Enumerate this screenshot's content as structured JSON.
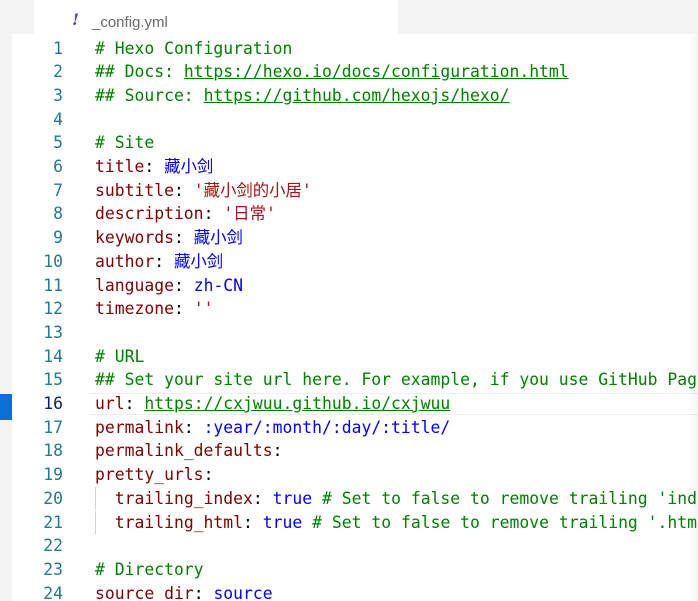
{
  "tab": {
    "icon": "yaml-exclamation-icon",
    "filename": "_config.yml"
  },
  "colors": {
    "key": "#800000",
    "comment": "#008000",
    "value": "#0000ff",
    "string": "#a31515",
    "line_number": "#237893",
    "active_line_number": "#0b216f",
    "activity_marker": "#0a6fd6"
  },
  "editor": {
    "active_line": 16,
    "lines": [
      {
        "number": "1",
        "parts": [
          {
            "t": "c",
            "text": "# Hexo Configuration"
          }
        ]
      },
      {
        "number": "2",
        "parts": [
          {
            "t": "c",
            "text": "## Docs: "
          },
          {
            "t": "u",
            "text": "https://hexo.io/docs/configuration.html"
          }
        ]
      },
      {
        "number": "3",
        "parts": [
          {
            "t": "c",
            "text": "## Source: "
          },
          {
            "t": "u",
            "text": "https://github.com/hexojs/hexo/"
          }
        ]
      },
      {
        "number": "4",
        "parts": []
      },
      {
        "number": "5",
        "parts": [
          {
            "t": "c",
            "text": "# Site"
          }
        ]
      },
      {
        "number": "6",
        "parts": [
          {
            "t": "k",
            "text": "title"
          },
          {
            "t": "p",
            "text": ": "
          },
          {
            "t": "v",
            "text": "藏小剑"
          }
        ]
      },
      {
        "number": "7",
        "parts": [
          {
            "t": "k",
            "text": "subtitle"
          },
          {
            "t": "p",
            "text": ": "
          },
          {
            "t": "s",
            "text": "'藏小剑的小居'"
          }
        ]
      },
      {
        "number": "8",
        "parts": [
          {
            "t": "k",
            "text": "description"
          },
          {
            "t": "p",
            "text": ": "
          },
          {
            "t": "s",
            "text": "'日常'"
          }
        ]
      },
      {
        "number": "9",
        "parts": [
          {
            "t": "k",
            "text": "keywords"
          },
          {
            "t": "p",
            "text": ": "
          },
          {
            "t": "v",
            "text": "藏小剑"
          }
        ]
      },
      {
        "number": "10",
        "parts": [
          {
            "t": "k",
            "text": "author"
          },
          {
            "t": "p",
            "text": ": "
          },
          {
            "t": "v",
            "text": "藏小剑"
          }
        ]
      },
      {
        "number": "11",
        "parts": [
          {
            "t": "k",
            "text": "language"
          },
          {
            "t": "p",
            "text": ": "
          },
          {
            "t": "v",
            "text": "zh-CN"
          }
        ]
      },
      {
        "number": "12",
        "parts": [
          {
            "t": "k",
            "text": "timezone"
          },
          {
            "t": "p",
            "text": ": "
          },
          {
            "t": "s",
            "text": "''"
          }
        ]
      },
      {
        "number": "13",
        "parts": []
      },
      {
        "number": "14",
        "parts": [
          {
            "t": "c",
            "text": "# URL"
          }
        ]
      },
      {
        "number": "15",
        "parts": [
          {
            "t": "c",
            "text": "## Set your site url here. For example, if you use GitHub Page"
          }
        ]
      },
      {
        "number": "16",
        "parts": [
          {
            "t": "k",
            "text": "url"
          },
          {
            "t": "p",
            "text": ": "
          },
          {
            "t": "u",
            "text": "https://cxjwuu.github.io/cxjwuu"
          }
        ]
      },
      {
        "number": "17",
        "parts": [
          {
            "t": "k",
            "text": "permalink"
          },
          {
            "t": "p",
            "text": ": "
          },
          {
            "t": "v",
            "text": ":year/:month/:day/:title/"
          }
        ]
      },
      {
        "number": "18",
        "parts": [
          {
            "t": "k",
            "text": "permalink_defaults"
          },
          {
            "t": "p",
            "text": ":"
          }
        ]
      },
      {
        "number": "19",
        "parts": [
          {
            "t": "k",
            "text": "pretty_urls"
          },
          {
            "t": "p",
            "text": ":"
          }
        ]
      },
      {
        "number": "20",
        "indent": true,
        "parts": [
          {
            "t": "p",
            "text": "  "
          },
          {
            "t": "k",
            "text": "trailing_index"
          },
          {
            "t": "p",
            "text": ": "
          },
          {
            "t": "v",
            "text": "true"
          },
          {
            "t": "p",
            "text": " "
          },
          {
            "t": "c",
            "text": "# Set to false to remove trailing 'inde"
          }
        ]
      },
      {
        "number": "21",
        "indent": true,
        "parts": [
          {
            "t": "p",
            "text": "  "
          },
          {
            "t": "k",
            "text": "trailing_html"
          },
          {
            "t": "p",
            "text": ": "
          },
          {
            "t": "v",
            "text": "true"
          },
          {
            "t": "p",
            "text": " "
          },
          {
            "t": "c",
            "text": "# Set to false to remove trailing '.html"
          }
        ]
      },
      {
        "number": "22",
        "parts": []
      },
      {
        "number": "23",
        "parts": [
          {
            "t": "c",
            "text": "# Directory"
          }
        ]
      },
      {
        "number": "24",
        "parts": [
          {
            "t": "k",
            "text": "source_dir"
          },
          {
            "t": "p",
            "text": ": "
          },
          {
            "t": "v",
            "text": "source"
          }
        ]
      }
    ]
  }
}
